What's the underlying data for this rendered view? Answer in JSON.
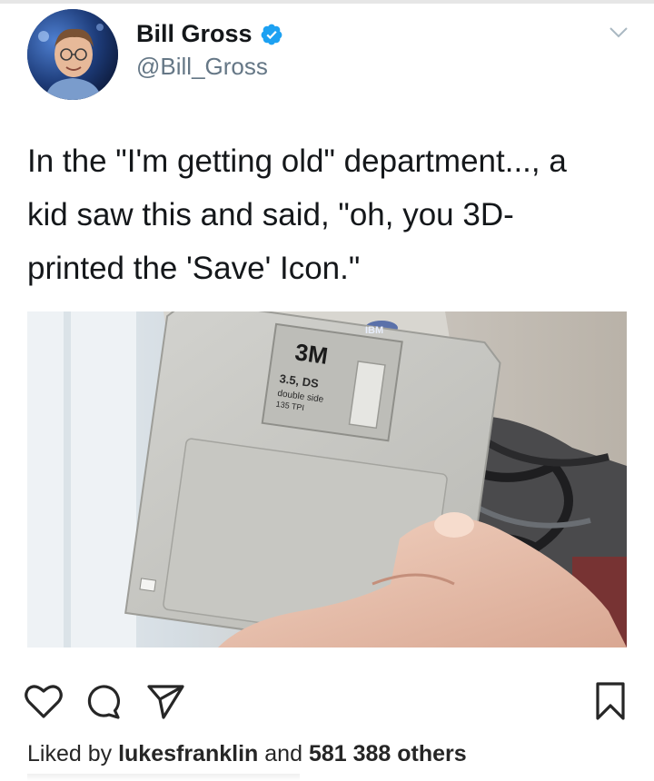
{
  "author": {
    "name": "Bill Gross",
    "handle": "@Bill_Gross",
    "verified": true
  },
  "tweet": {
    "lines": [
      "In the \"I'm getting old\" department..., a",
      "kid saw this and said, \"oh, you 3D-",
      "printed the 'Save' Icon.\""
    ]
  },
  "photo": {
    "disk_brand": "3M",
    "disk_line1": "3.5, DS",
    "disk_line2": "double side",
    "disk_line3": "135 TPI",
    "corner_brand": "IBM"
  },
  "icons": {
    "like": "heart-icon",
    "comment": "comment-icon",
    "share": "send-icon",
    "save": "bookmark-icon",
    "menu": "chevron-down-icon",
    "verified": "verified-badge-icon"
  },
  "colors": {
    "verified_blue": "#1da1f2",
    "handle_gray": "#657786",
    "text_dark": "#14171a"
  },
  "engagement": {
    "liked_by_prefix": "Liked by",
    "liked_by_user": "lukesfranklin",
    "and_text": "and",
    "others_count": "581 388 others"
  }
}
